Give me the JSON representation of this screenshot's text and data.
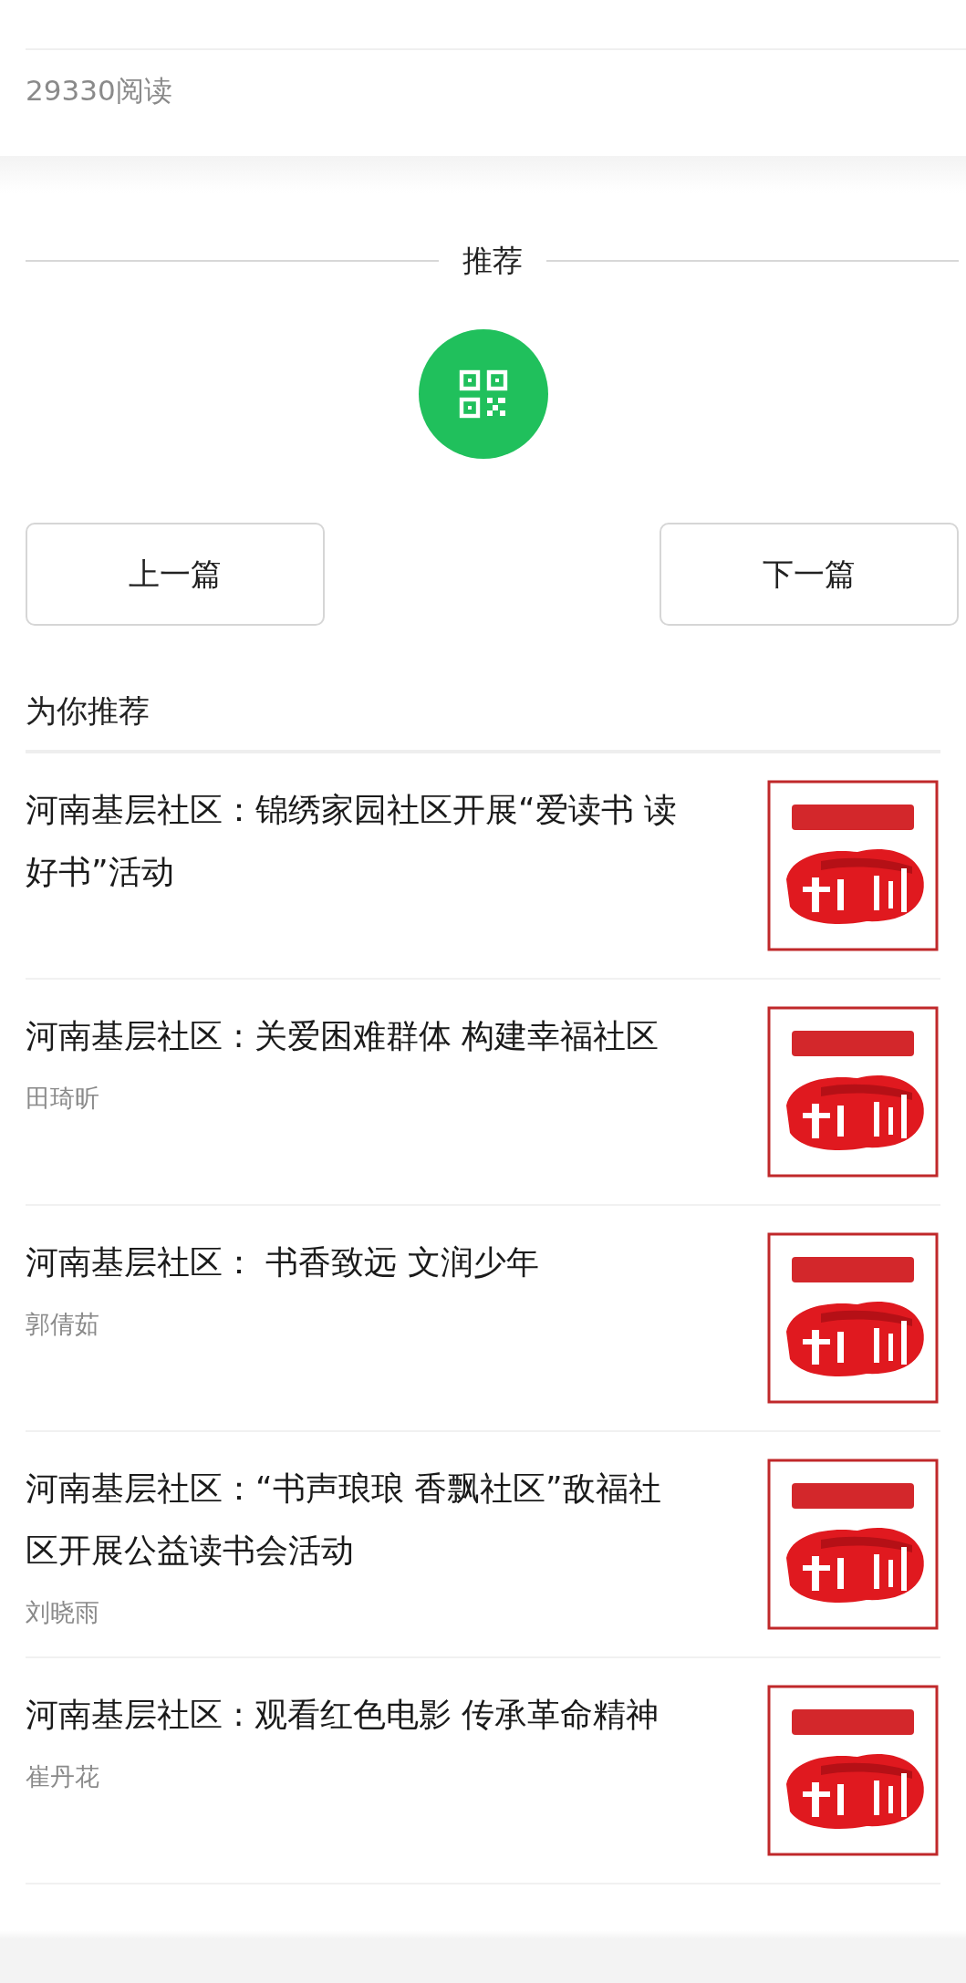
{
  "read_count": "29330阅读",
  "section_title": "推荐",
  "nav_buttons": [
    {
      "label": "上一篇"
    },
    {
      "label": "下一篇"
    }
  ],
  "recommend_heading": "为你推荐",
  "articles": [
    {
      "title": "河南基层社区：锦绣家园社区开展“爱读书 读好书”活动"
    },
    {
      "title": "河南基层社区 : 关爱困难群体 构建幸福社区",
      "author": "田琦昕"
    },
    {
      "title": "河南基层社区： 书香致远 文润少年",
      "author": "郭倩茹"
    },
    {
      "title": "河南基层社区：“书声琅琅 香飘社区”敌福社区开展公益读书会活动",
      "author": "刘晓雨"
    },
    {
      "title": "河南基层社区 : 观看红色电影 传承革命精神",
      "author": "崔丹花"
    }
  ]
}
